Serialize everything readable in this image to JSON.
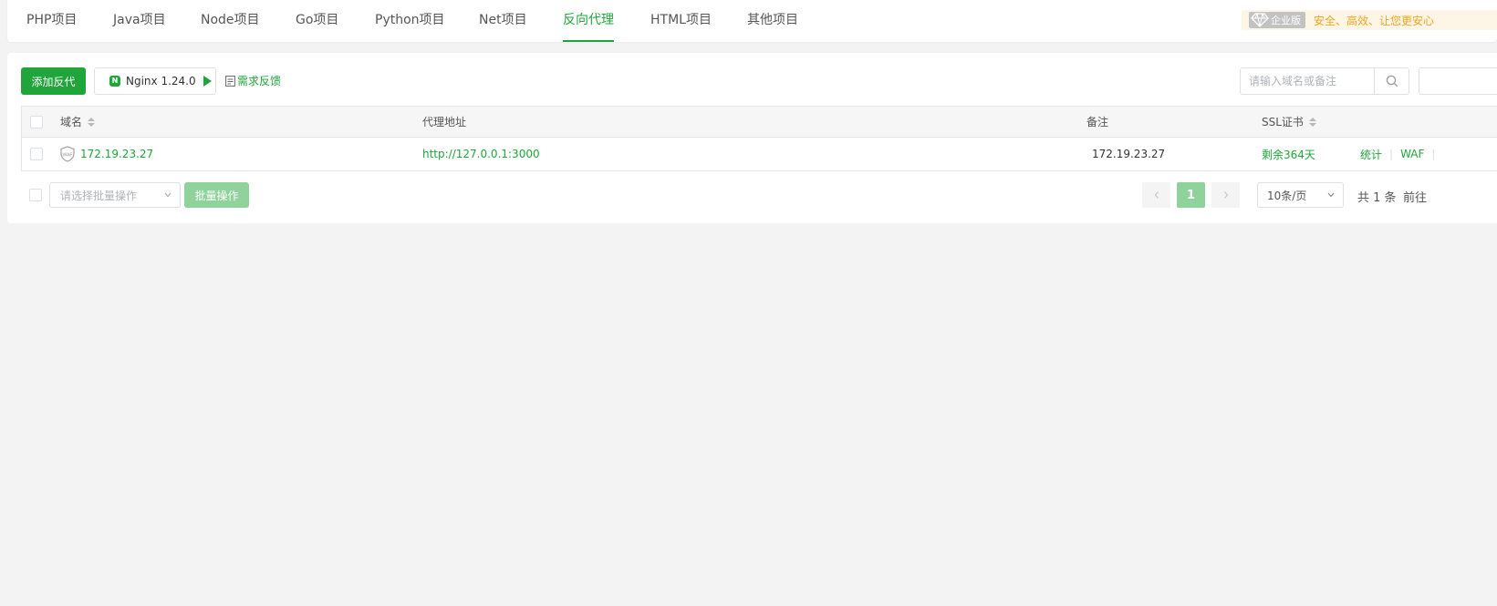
{
  "tabs": [
    {
      "label": "PHP项目",
      "active": false
    },
    {
      "label": "Java项目",
      "active": false
    },
    {
      "label": "Node项目",
      "active": false
    },
    {
      "label": "Go项目",
      "active": false
    },
    {
      "label": "Python项目",
      "active": false
    },
    {
      "label": "Net项目",
      "active": false
    },
    {
      "label": "反向代理",
      "active": true
    },
    {
      "label": "HTML项目",
      "active": false
    },
    {
      "label": "其他项目",
      "active": false
    }
  ],
  "promo": {
    "badge": "企业版",
    "text": "安全、高效、让您更安心"
  },
  "toolbar": {
    "add_label": "添加反代",
    "nginx_label": "Nginx 1.24.0",
    "nginx_logo": "N",
    "feedback_label": "需求反馈",
    "search_placeholder": "请输入域名或备注"
  },
  "table": {
    "columns": {
      "domain": "域名",
      "proxy": "代理地址",
      "remark": "备注",
      "ssl": "SSL证书"
    },
    "rows": [
      {
        "domain": "172.19.23.27",
        "waf_badge": "WAF",
        "proxy": "http://127.0.0.1:3000",
        "remark": "172.19.23.27",
        "ssl": "剩余364天",
        "ops": [
          "统计",
          "WAF"
        ]
      }
    ]
  },
  "footer": {
    "batch_placeholder": "请选择批量操作",
    "batch_button": "批量操作",
    "current_page": "1",
    "page_size": "10条/页",
    "total": "共 1 条",
    "goto": "前往"
  },
  "colors": {
    "accent": "#20a53a",
    "accent_light": "#90d29c",
    "promo_text": "#f2a51c"
  }
}
